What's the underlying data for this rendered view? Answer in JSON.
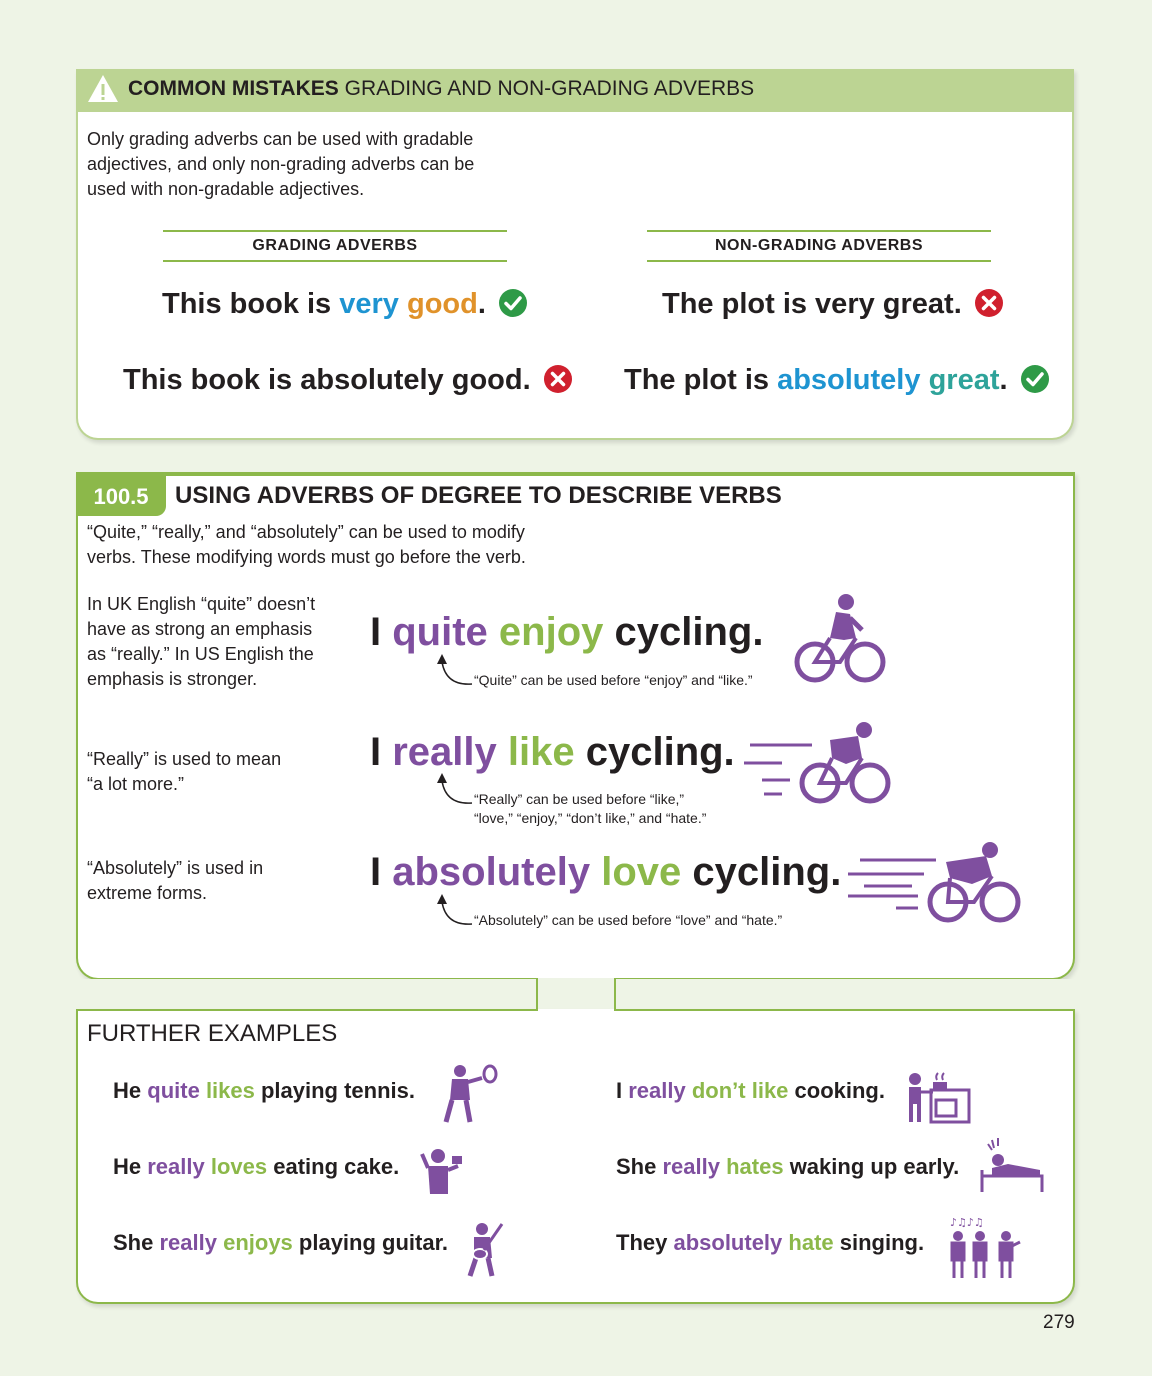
{
  "common_mistakes": {
    "title_bold": "COMMON MISTAKES",
    "title_rest": " GRADING AND NON-GRADING ADVERBS",
    "intro": "Only grading adverbs can be used with gradable adjectives, and only non-grading adverbs can be used with non-gradable adjectives.",
    "grading_header": "GRADING ADVERBS",
    "non_grading_header": "NON-GRADING ADVERBS",
    "ex1": {
      "pre": "This book is ",
      "adverb": "very",
      "adj": "good",
      "post": "."
    },
    "ex2": "This book is absolutely good.",
    "ex3": "The plot is very great.",
    "ex4": {
      "pre": "The plot is ",
      "adverb": "absolutely",
      "adj": "great",
      "post": "."
    }
  },
  "section": {
    "number": "100.5",
    "title": "USING ADVERBS OF DEGREE TO DESCRIBE VERBS",
    "intro": "“Quite,” “really,” and “absolutely” can be used to modify verbs. These modifying words must go before the verb.",
    "rows": [
      {
        "side_note": "In UK English “quite” doesn’t have as strong an emphasis as “really.” In US English the emphasis is stronger.",
        "subject": "I ",
        "adverb": "quite",
        "verb": "enjoy",
        "rest": " cycling.",
        "note_line1": "“Quite” can be used before “enjoy” and “like.”",
        "note_line2": ""
      },
      {
        "side_note": "“Really” is used to mean “a lot more.”",
        "subject": "I ",
        "adverb": "really",
        "verb": "like",
        "rest": " cycling.",
        "note_line1": "“Really” can be used before “like,”",
        "note_line2": "“love,” “enjoy,” “don’t like,” and “hate.”"
      },
      {
        "side_note": "“Absolutely” is used in extreme forms.",
        "subject": "I ",
        "adverb": "absolutely",
        "verb": "love",
        "rest": " cycling.",
        "note_line1": "“Absolutely” can be used before “love” and “hate.”",
        "note_line2": ""
      }
    ]
  },
  "further": {
    "title": "FURTHER EXAMPLES",
    "examples": [
      {
        "pre": "He ",
        "adverb": "quite",
        "verb": "likes",
        "rest": " playing tennis.",
        "icon": "tennis-player-icon"
      },
      {
        "pre": "I ",
        "adverb": "really",
        "verb": "don’t like",
        "rest": " cooking.",
        "icon": "cooking-icon"
      },
      {
        "pre": "He ",
        "adverb": "really",
        "verb": "loves",
        "rest": " eating cake.",
        "icon": "cake-eating-icon"
      },
      {
        "pre": "She ",
        "adverb": "really",
        "verb": "hates",
        "rest": " waking up early.",
        "icon": "waking-up-icon"
      },
      {
        "pre": "She ",
        "adverb": "really",
        "verb": "enjoys",
        "rest": " playing guitar.",
        "icon": "guitar-player-icon"
      },
      {
        "pre": "They ",
        "adverb": "absolutely",
        "verb": "hate",
        "rest": " singing.",
        "icon": "singing-group-icon"
      }
    ]
  },
  "page_number": "279",
  "colors": {
    "purple": "#7f4f9f",
    "green": "#8cb84a",
    "blue": "#1e94d1",
    "orange": "#e0922a",
    "teal": "#2ea39a",
    "correct": "#2e9a47",
    "wrong": "#d0202e"
  }
}
